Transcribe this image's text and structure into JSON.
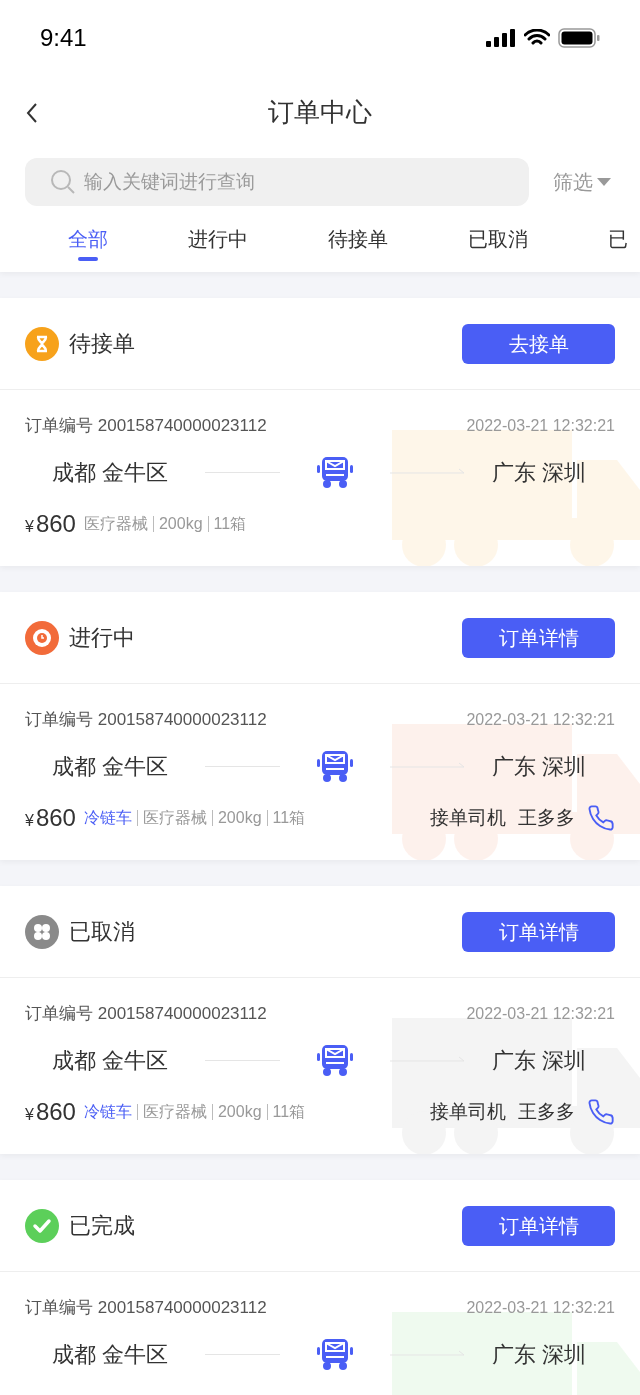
{
  "status_bar": {
    "time": "9:41"
  },
  "header": {
    "title": "订单中心"
  },
  "search": {
    "placeholder": "输入关键词进行查询"
  },
  "filter": {
    "label": "筛选"
  },
  "tabs": [
    {
      "label": "全部",
      "selected": true
    },
    {
      "label": "进行中",
      "selected": false
    },
    {
      "label": "待接单",
      "selected": false
    },
    {
      "label": "已取消",
      "selected": false
    },
    {
      "label": "已",
      "selected": false
    }
  ],
  "orders": [
    {
      "kind": "pending",
      "status": "待接单",
      "color": "#f7a21b",
      "action": "去接单",
      "order_label": "订单编号",
      "order_no": "200158740000023112",
      "time": "2022-03-21 12:32:21",
      "from": "成都 金牛区",
      "to": "广东 深圳",
      "currency": "¥",
      "price": "860",
      "tags": [
        {
          "kind": "plain",
          "text": "医疗器械"
        },
        {
          "kind": "plain",
          "text": "200kg"
        },
        {
          "kind": "plain",
          "text": "11箱"
        }
      ]
    },
    {
      "kind": "ongoing",
      "status": "进行中",
      "color": "#f26b3a",
      "action": "订单详情",
      "order_label": "订单编号",
      "order_no": "200158740000023112",
      "time": "2022-03-21 12:32:21",
      "from": "成都 金牛区",
      "to": "广东 深圳",
      "currency": "¥",
      "price": "860",
      "tags": [
        {
          "kind": "highlight",
          "text": "冷链车"
        },
        {
          "kind": "plain",
          "text": "医疗器械"
        },
        {
          "kind": "plain",
          "text": "200kg"
        },
        {
          "kind": "plain",
          "text": "11箱"
        }
      ],
      "driver_label": "接单司机",
      "driver_name": "王多多"
    },
    {
      "kind": "cancelled",
      "status": "已取消",
      "color": "#8a8a8a",
      "action": "订单详情",
      "order_label": "订单编号",
      "order_no": "200158740000023112",
      "time": "2022-03-21 12:32:21",
      "from": "成都 金牛区",
      "to": "广东 深圳",
      "currency": "¥",
      "price": "860",
      "tags": [
        {
          "kind": "highlight",
          "text": "冷链车"
        },
        {
          "kind": "plain",
          "text": "医疗器械"
        },
        {
          "kind": "plain",
          "text": "200kg"
        },
        {
          "kind": "plain",
          "text": "11箱"
        }
      ],
      "driver_label": "接单司机",
      "driver_name": "王多多"
    },
    {
      "kind": "done",
      "status": "已完成",
      "color": "#5ccf5a",
      "action": "订单详情",
      "order_label": "订单编号",
      "order_no": "200158740000023112",
      "time": "2022-03-21 12:32:21",
      "from": "成都 金牛区",
      "to": "广东 深圳"
    }
  ]
}
